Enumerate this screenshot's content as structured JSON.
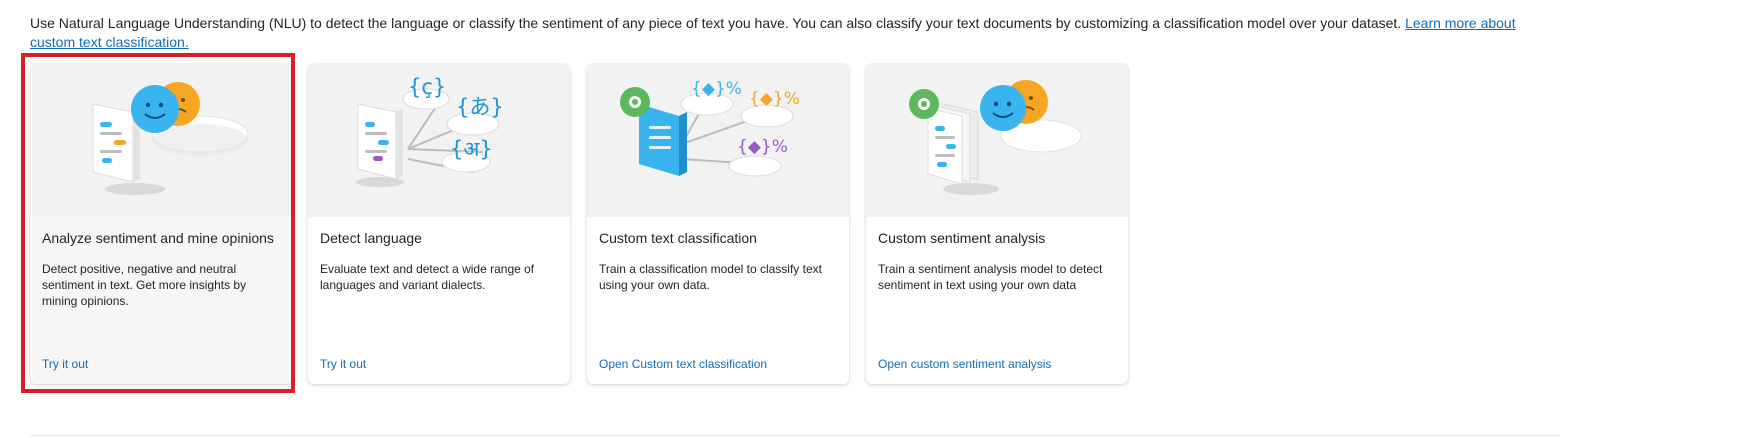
{
  "intro": {
    "text": "Use Natural Language Understanding (NLU) to detect the language or classify the sentiment of any piece of text you have. You can also classify your text documents by customizing a classification model over your dataset. ",
    "link": "Learn more about custom text classification."
  },
  "cards": [
    {
      "title": "Analyze sentiment and mine opinions",
      "description": "Detect positive, negative and neutral sentiment in text. Get more insights by mining opinions.",
      "action": "Try it out",
      "illustration": "sentiment-illustration"
    },
    {
      "title": "Detect language",
      "description": "Evaluate text and detect a wide range of languages and variant dialects.",
      "action": "Try it out",
      "illustration": "language-illustration",
      "language_glyphs": [
        "{ç}",
        "{あ}",
        "{अ}"
      ]
    },
    {
      "title": "Custom text classification",
      "description": "Train a classification model to classify text using your own data.",
      "action": "Open Custom text classification",
      "illustration": "classification-illustration"
    },
    {
      "title": "Custom sentiment analysis",
      "description": "Train a sentiment analysis model to detect sentiment in text using your own data",
      "action": "Open custom sentiment analysis",
      "illustration": "custom-sentiment-illustration"
    }
  ],
  "colors": {
    "link": "#0f6cbd",
    "highlight": "#d71f27",
    "art_bg": "#f2f2f2",
    "blue": "#3ab4ef",
    "orange": "#f5a623",
    "green": "#5bb85d",
    "purple": "#9b59c8"
  }
}
